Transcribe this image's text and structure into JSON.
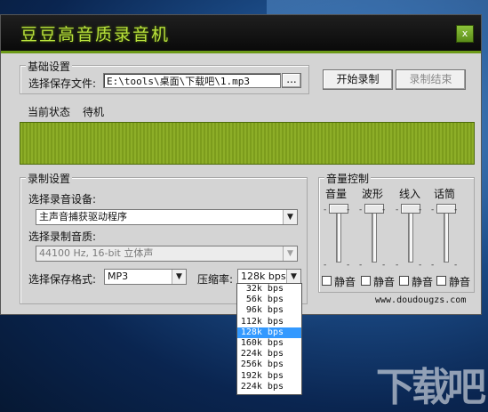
{
  "window": {
    "title": "豆豆高音质录音机",
    "close_glyph": "x"
  },
  "basic": {
    "group_title": "基础设置",
    "save_file_label": "选择保存文件:",
    "save_file_value": "E:\\tools\\桌面\\下载吧\\1.mp3",
    "browse_label": "..."
  },
  "buttons": {
    "start": "开始录制",
    "stop": "录制结束"
  },
  "status": {
    "label": "当前状态",
    "value": "待机"
  },
  "record": {
    "group_title": "录制设置",
    "device_label": "选择录音设备:",
    "device_value": "主声音捕获驱动程序",
    "quality_label": "选择录制音质:",
    "quality_value": "44100 Hz, 16-bit 立体声",
    "format_label": "选择保存格式:",
    "format_value": "MP3",
    "compress_label": "压缩率:",
    "compress_value": "128k bps"
  },
  "volume": {
    "group_title": "音量控制",
    "channels": [
      {
        "label": "音量",
        "mute": "静音"
      },
      {
        "label": "波形",
        "mute": "静音"
      },
      {
        "label": "线入",
        "mute": "静音"
      },
      {
        "label": "话筒",
        "mute": "静音"
      }
    ]
  },
  "website": "www.doudougzs.com",
  "compress_options": [
    "32k bps",
    "56k bps",
    "96k bps",
    "112k bps",
    "128k bps",
    "160k bps",
    "224k bps",
    "256k bps",
    "192k bps",
    "224k bps"
  ],
  "compress_selected": "128k bps",
  "watermark": "下载吧"
}
